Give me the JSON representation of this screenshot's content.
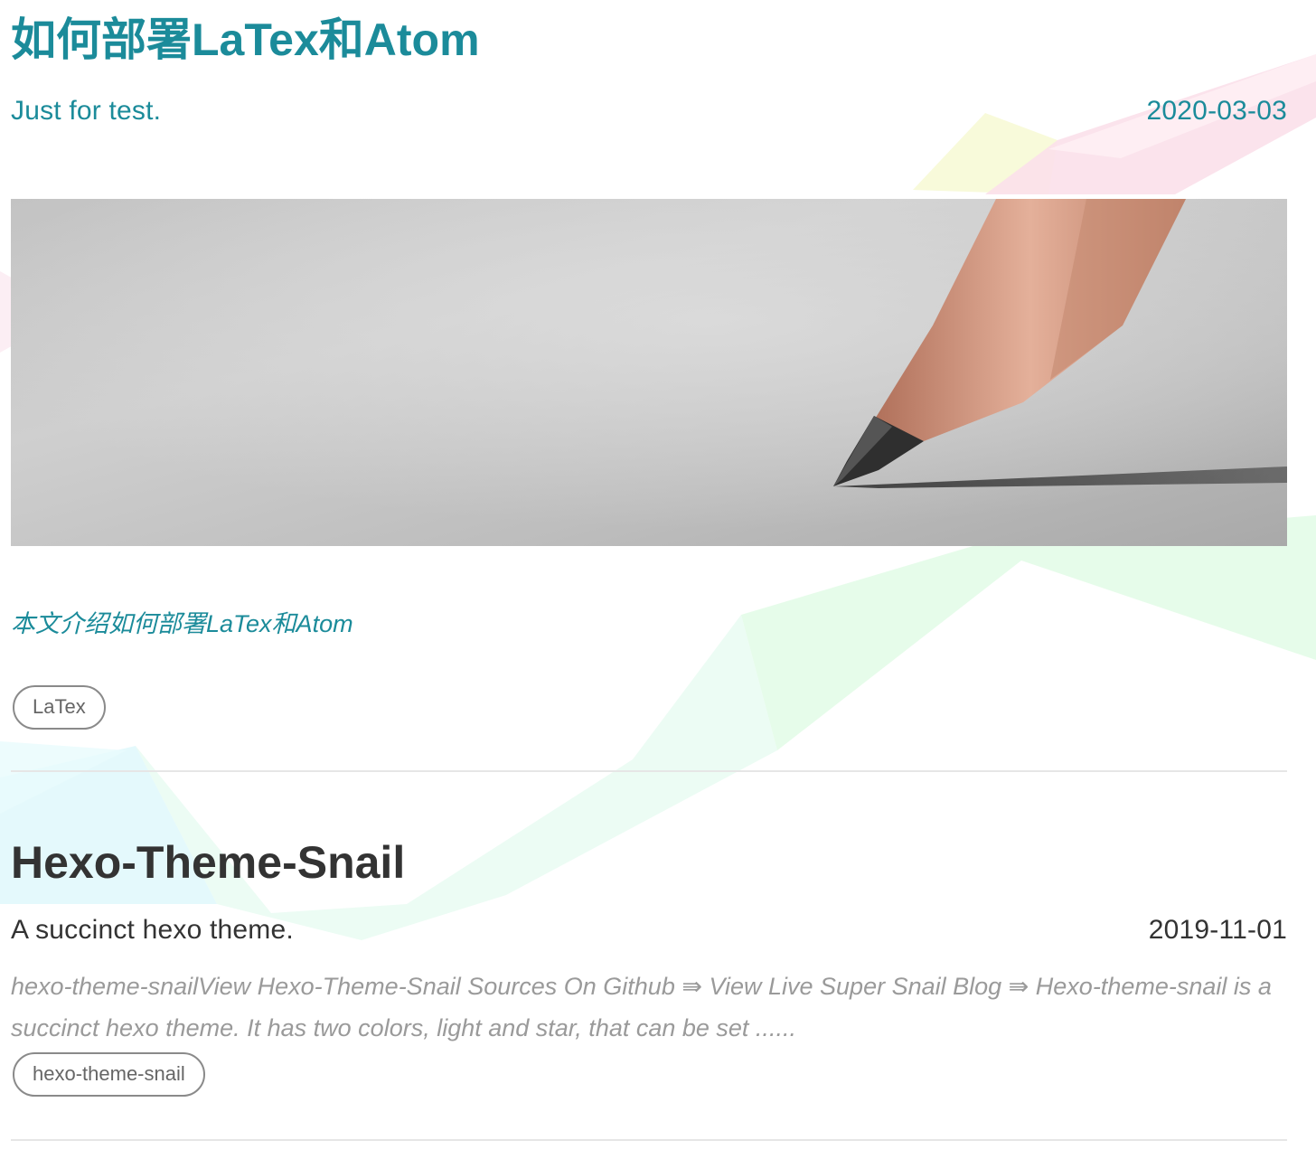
{
  "posts": [
    {
      "title": "如何部署LaTex和Atom",
      "subtitle": "Just for test.",
      "date": "2020-03-03",
      "excerpt": "本文介绍如何部署LaTex和Atom",
      "tags": [
        "LaTex"
      ]
    },
    {
      "title": "Hexo-Theme-Snail",
      "subtitle": "A succinct hexo theme.",
      "date": "2019-11-01",
      "excerpt": "hexo-theme-snailView Hexo-Theme-Snail Sources On Github ⇛ View Live Super Snail Blog ⇛ Hexo-theme-snail is a succinct hexo theme. It has two colors, light and star, that can be set ......",
      "tags": [
        "hexo-theme-snail"
      ]
    }
  ],
  "colors": {
    "accent": "#1b8b9a",
    "title_dark": "#333333",
    "excerpt_gray": "#9a9a9a"
  },
  "icons": {
    "cover_image": "pencil-on-paper-photo"
  }
}
